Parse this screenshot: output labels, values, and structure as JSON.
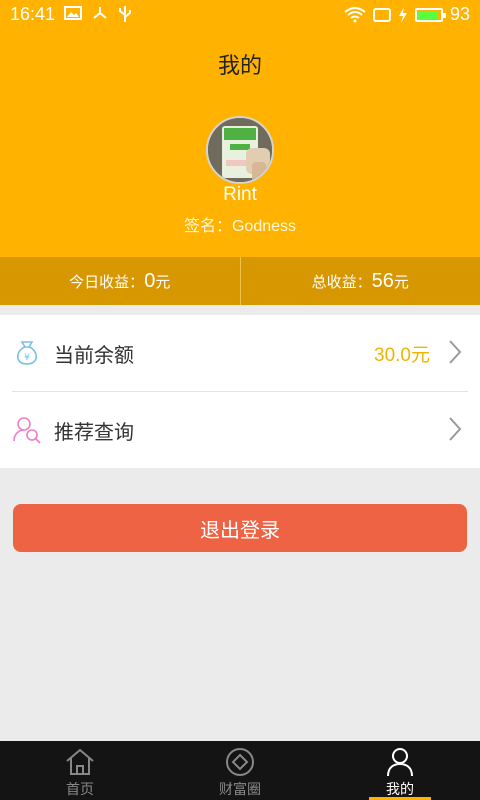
{
  "status_bar": {
    "time": "16:41",
    "battery": "93",
    "battery_level": 0.93
  },
  "header": {
    "title": "我的",
    "username": "Rint",
    "signature": "签名：Godness"
  },
  "earnings": {
    "today_label": "今日收益：",
    "today_value": "0",
    "today_unit": "元",
    "total_label": "总收益：",
    "total_value": "56",
    "total_unit": "元"
  },
  "menu": {
    "balance_label": "当前余额",
    "balance_value": "30.0元",
    "referral_label": "推荐查询"
  },
  "logout_label": "退出登录",
  "tabs": [
    {
      "label": "首页",
      "icon": "home-icon"
    },
    {
      "label": "财富圈",
      "icon": "wealth-circle-icon"
    },
    {
      "label": "我的",
      "icon": "profile-icon",
      "active": true
    }
  ],
  "colors": {
    "brand": "#ffb300",
    "earnings_bar": "#d69700",
    "logout": "#ee6344",
    "balance_value": "#f0b400"
  }
}
